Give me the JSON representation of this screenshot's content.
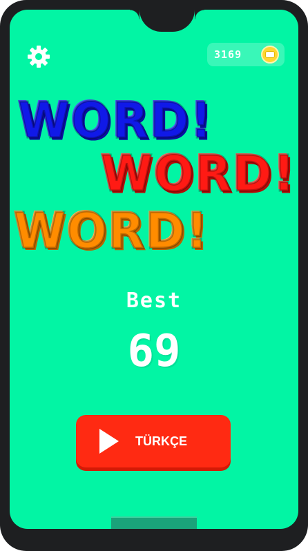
{
  "coins": {
    "count": "3169"
  },
  "logo": {
    "words": [
      "WORD!",
      "WORD!",
      "WORD!"
    ]
  },
  "best": {
    "label": "Best",
    "score": "69"
  },
  "play_button": {
    "label": "TÜRKÇE"
  },
  "colors": {
    "background": "#02f5a4",
    "logo_blue": "#1019e8",
    "logo_red": "#ff1a14",
    "logo_orange": "#ff8c00",
    "play_button": "#ff2a12"
  },
  "icons": {
    "settings": "gear-icon",
    "coin": "coin-icon",
    "play": "play-icon"
  }
}
